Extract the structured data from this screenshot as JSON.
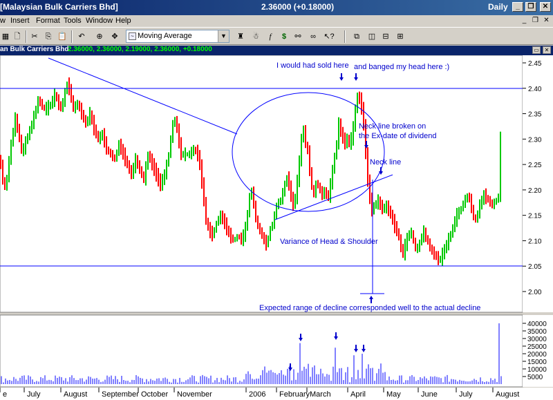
{
  "window": {
    "title": "[Malaysian Bulk Carriers Bhd]",
    "quote": "2.36000 (+0.18000)",
    "period": "Daily",
    "minimize_glyph": "_",
    "restore_glyph": "❐",
    "close_glyph": "✕"
  },
  "menu": {
    "items": [
      "w",
      "Insert",
      "Format",
      "Tools",
      "Window",
      "Help"
    ],
    "mdi_min": "_",
    "mdi_restore": "❐",
    "mdi_close": "✕"
  },
  "toolbar": {
    "indicator_selected": "Moving Average",
    "icons": [
      "chart-icon",
      "preview-icon",
      "cut-icon",
      "copy-icon",
      "paste-icon",
      "undo-icon",
      "crosshair-icon",
      "move-icon",
      "indicator-icon",
      "expert-icon",
      "function-icon",
      "dollar-icon",
      "explore-icon",
      "help-pointer-icon",
      "layout-icon"
    ]
  },
  "chart_header": {
    "security": "an Bulk Carriers Bhd",
    "values": "2.36000, 2.36000, 2.19000, 2.36000, +0.18000"
  },
  "colors": {
    "up_bar": "#00c800",
    "down_bar": "#ff0000",
    "line": "#0000ff",
    "annotation": "#0000cc",
    "title_bar": "#0a246a"
  },
  "annotations": {
    "sold": "I would had sold here",
    "banged": "and banged my head here :)",
    "neck_broken_1": "Neck line broken on",
    "neck_broken_2": "the Ex-date of dividend",
    "neck_line": "Neck line",
    "variance": "Variance of Head & Shoulder",
    "expected": "Expected range of decline corresponded well to the actual decline"
  },
  "chart_data": {
    "type": "bar",
    "price_axis": {
      "ticks": [
        "2.45",
        "2.40",
        "2.35",
        "2.30",
        "2.25",
        "2.20",
        "2.15",
        "2.10",
        "2.05",
        "2.00"
      ],
      "range": [
        1.96,
        2.47
      ]
    },
    "volume_axis": {
      "ticks": [
        "40000",
        "35000",
        "30000",
        "25000",
        "20000",
        "15000",
        "10000",
        "5000"
      ],
      "range": [
        0,
        42000
      ]
    },
    "x_labels": [
      "e",
      "July",
      "August",
      "September",
      "October",
      "November",
      "2006",
      "February",
      "March",
      "April",
      "May",
      "June",
      "July",
      "August"
    ],
    "price_path": [
      [
        0,
        2.26
      ],
      [
        4,
        2.22
      ],
      [
        8,
        2.2
      ],
      [
        14,
        2.27
      ],
      [
        18,
        2.31
      ],
      [
        22,
        2.34
      ],
      [
        27,
        2.31
      ],
      [
        32,
        2.27
      ],
      [
        38,
        2.3
      ],
      [
        44,
        2.32
      ],
      [
        50,
        2.35
      ],
      [
        56,
        2.38
      ],
      [
        62,
        2.36
      ],
      [
        68,
        2.36
      ],
      [
        74,
        2.37
      ],
      [
        80,
        2.39
      ],
      [
        86,
        2.36
      ],
      [
        91,
        2.37
      ],
      [
        96,
        2.41
      ],
      [
        100,
        2.4
      ],
      [
        106,
        2.36
      ],
      [
        112,
        2.37
      ],
      [
        118,
        2.35
      ],
      [
        124,
        2.33
      ],
      [
        130,
        2.35
      ],
      [
        136,
        2.32
      ],
      [
        142,
        2.3
      ],
      [
        148,
        2.31
      ],
      [
        154,
        2.28
      ],
      [
        160,
        2.27
      ],
      [
        166,
        2.26
      ],
      [
        172,
        2.29
      ],
      [
        178,
        2.27
      ],
      [
        184,
        2.25
      ],
      [
        190,
        2.23
      ],
      [
        196,
        2.26
      ],
      [
        202,
        2.24
      ],
      [
        208,
        2.22
      ],
      [
        214,
        2.27
      ],
      [
        220,
        2.25
      ],
      [
        226,
        2.23
      ],
      [
        232,
        2.21
      ],
      [
        238,
        2.23
      ],
      [
        244,
        2.27
      ],
      [
        250,
        2.33
      ],
      [
        254,
        2.34
      ],
      [
        258,
        2.3
      ],
      [
        262,
        2.27
      ],
      [
        268,
        2.27
      ],
      [
        274,
        2.27
      ],
      [
        280,
        2.28
      ],
      [
        286,
        2.27
      ],
      [
        290,
        2.24
      ],
      [
        294,
        2.19
      ],
      [
        298,
        2.14
      ],
      [
        302,
        2.12
      ],
      [
        308,
        2.11
      ],
      [
        314,
        2.14
      ],
      [
        320,
        2.15
      ],
      [
        326,
        2.13
      ],
      [
        332,
        2.11
      ],
      [
        338,
        2.1
      ],
      [
        344,
        2.11
      ],
      [
        350,
        2.1
      ],
      [
        356,
        2.13
      ],
      [
        360,
        2.18
      ],
      [
        364,
        2.2
      ],
      [
        368,
        2.16
      ],
      [
        372,
        2.13
      ],
      [
        376,
        2.12
      ],
      [
        382,
        2.1
      ],
      [
        386,
        2.09
      ],
      [
        390,
        2.12
      ],
      [
        396,
        2.14
      ],
      [
        400,
        2.17
      ],
      [
        406,
        2.18
      ],
      [
        412,
        2.21
      ],
      [
        416,
        2.23
      ],
      [
        420,
        2.19
      ],
      [
        424,
        2.17
      ],
      [
        428,
        2.19
      ],
      [
        434,
        2.27
      ],
      [
        438,
        2.33
      ],
      [
        442,
        2.29
      ],
      [
        446,
        2.27
      ],
      [
        450,
        2.21
      ],
      [
        454,
        2.19
      ],
      [
        458,
        2.22
      ],
      [
        462,
        2.2
      ],
      [
        466,
        2.19
      ],
      [
        470,
        2.2
      ],
      [
        474,
        2.18
      ],
      [
        478,
        2.21
      ],
      [
        482,
        2.25
      ],
      [
        486,
        2.28
      ],
      [
        490,
        2.33
      ],
      [
        494,
        2.31
      ],
      [
        498,
        2.29
      ],
      [
        502,
        2.3
      ],
      [
        506,
        2.29
      ],
      [
        510,
        2.31
      ],
      [
        514,
        2.36
      ],
      [
        518,
        2.39
      ],
      [
        522,
        2.37
      ],
      [
        526,
        2.33
      ],
      [
        530,
        2.25
      ],
      [
        534,
        2.19
      ],
      [
        538,
        2.16
      ],
      [
        542,
        2.17
      ],
      [
        546,
        2.18
      ],
      [
        550,
        2.17
      ],
      [
        554,
        2.16
      ],
      [
        558,
        2.17
      ],
      [
        562,
        2.16
      ],
      [
        566,
        2.15
      ],
      [
        570,
        2.13
      ],
      [
        574,
        2.12
      ],
      [
        578,
        2.1
      ],
      [
        582,
        2.07
      ],
      [
        586,
        2.09
      ],
      [
        590,
        2.11
      ],
      [
        594,
        2.12
      ],
      [
        598,
        2.1
      ],
      [
        602,
        2.08
      ],
      [
        606,
        2.09
      ],
      [
        612,
        2.12
      ],
      [
        618,
        2.1
      ],
      [
        624,
        2.08
      ],
      [
        630,
        2.07
      ],
      [
        636,
        2.06
      ],
      [
        642,
        2.08
      ],
      [
        648,
        2.1
      ],
      [
        654,
        2.12
      ],
      [
        660,
        2.15
      ],
      [
        666,
        2.16
      ],
      [
        672,
        2.18
      ],
      [
        678,
        2.19
      ],
      [
        684,
        2.15
      ],
      [
        688,
        2.14
      ],
      [
        694,
        2.17
      ],
      [
        700,
        2.19
      ],
      [
        706,
        2.18
      ],
      [
        712,
        2.17
      ],
      [
        718,
        2.18
      ],
      [
        722,
        2.19
      ],
      [
        725,
        2.36
      ]
    ],
    "volume_spikes": [
      [
        419,
        12000
      ],
      [
        435,
        27000
      ],
      [
        486,
        24000
      ],
      [
        512,
        19000
      ],
      [
        525,
        20000
      ],
      [
        721,
        40000
      ]
    ],
    "volume_base": [
      1000,
      6000
    ]
  }
}
